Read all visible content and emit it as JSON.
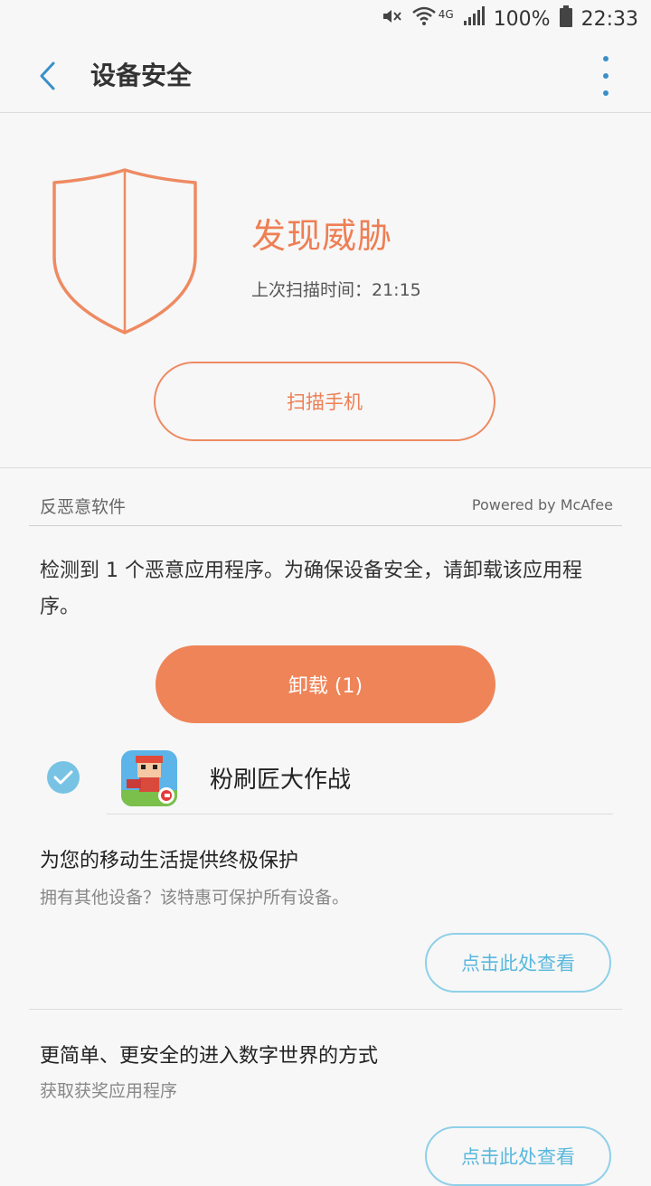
{
  "status_bar": {
    "battery": "100%",
    "time": "22:33",
    "network": "4G"
  },
  "header": {
    "title": "设备安全"
  },
  "hero": {
    "status": "发现威胁",
    "last_scan": "上次扫描时间：21:15",
    "scan_button": "扫描手机"
  },
  "anti_malware": {
    "title": "反恶意软件",
    "powered_by": "Powered by McAfee",
    "description": "检测到 1 个恶意应用程序。为确保设备安全，请卸载该应用程序。",
    "uninstall_button": "卸载 (1)",
    "app": {
      "name": "粉刷匠大作战",
      "checked": true
    }
  },
  "promos": [
    {
      "title": "为您的移动生活提供终极保护",
      "subtitle": "拥有其他设备？该特惠可保护所有设备。",
      "button": "点击此处查看"
    },
    {
      "title": "更简单、更安全的进入数字世界的方式",
      "subtitle": "获取获奖应用程序",
      "button": "点击此处查看"
    }
  ],
  "colors": {
    "threat": "#ee7f54",
    "accent_blue": "#3a8fc9",
    "view_button": "#5ab8dc"
  }
}
